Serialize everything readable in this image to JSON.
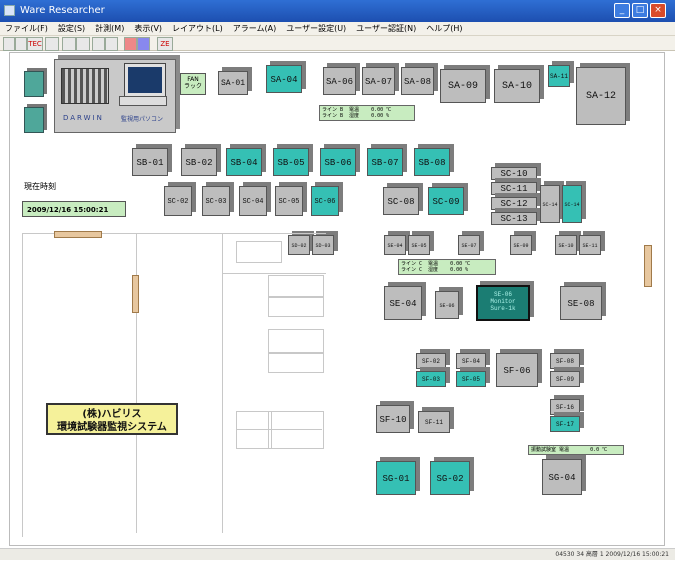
{
  "window": {
    "title": "Ware Researcher"
  },
  "menu": [
    "ファイル(F)",
    "設定(S)",
    "計測(M)",
    "表示(V)",
    "レイアウト(L)",
    "アラーム(A)",
    "ユーザー設定(U)",
    "ユーザー認証(N)",
    "ヘルプ(H)"
  ],
  "toolbar": {
    "buttons": [
      "",
      "",
      "TEC",
      "",
      "",
      "",
      "",
      "",
      "",
      "",
      "",
      "ZE"
    ]
  },
  "left_panel": {
    "darwin_label": "DARWIN",
    "pc_label": "監視用パソコン",
    "fan_rack": "FAN\nラック"
  },
  "clock": {
    "label": "現在時刻",
    "value": "2009/12/16  15:00:21"
  },
  "company": {
    "line1": "(株)ハビリス",
    "line2": "環境試験器監視システム"
  },
  "units": {
    "SA-01": "SA-01",
    "SA-04": "SA-04",
    "SA-06": "SA-06",
    "SA-07": "SA-07",
    "SA-08": "SA-08",
    "SA-09": "SA-09",
    "SA-10": "SA-10",
    "SA-11": "SA-11",
    "SA-12": "SA-12",
    "SB-01": "SB-01",
    "SB-02": "SB-02",
    "SB-04": "SB-04",
    "SB-05": "SB-05",
    "SB-06": "SB-06",
    "SB-07": "SB-07",
    "SB-08": "SB-08",
    "SC-02": "SC-02",
    "SC-03": "SC-03",
    "SC-04": "SC-04",
    "SC-05": "SC-05",
    "SC-06": "SC-06",
    "SC-08": "SC-08",
    "SC-09": "SC-09",
    "SC-10": "SC-10",
    "SC-11": "SC-11",
    "SC-12": "SC-12",
    "SC-13": "SC-13",
    "SC-14a": "SC-14",
    "SC-14b": "SC-14",
    "SD-02": "SD-02",
    "SD-03": "SD-03",
    "SE-04a": "SE-04",
    "SE-05": "SE-05",
    "SE-06": "SE-06",
    "SE-07": "SE-07",
    "SE-08a": "SE-08",
    "SE-09": "SE-09",
    "SE-10": "SE-10",
    "SE-11": "SE-11",
    "SE-04": "SE-04",
    "SE-06b": "SE-06",
    "SE-08": "SE-08",
    "monitor": "SE-06\nMonitor\nSure-1k",
    "SF-02": "SF-02",
    "SF-03": "SF-03",
    "SF-04": "SF-04",
    "SF-05": "SF-05",
    "SF-06": "SF-06",
    "SF-08": "SF-08",
    "SF-09": "SF-09",
    "SF-10": "SF-10",
    "SF-11": "SF-11",
    "SF-16": "SF-16",
    "SF-17": "SF-17",
    "SG-01": "SG-01",
    "SG-02": "SG-02",
    "SG-04": "SG-04"
  },
  "readouts": {
    "lineB": "ライン B  電温    0.00 ℃\nライン B  湿度    0.00 %",
    "lineC": "ライン C  電温    0.00 ℃\nライン C  湿度    0.00 %",
    "vib": "振動試験室 電温       0.0 ℃"
  },
  "status": {
    "text": "04530  34 高層 1  2009/12/16  15:00:21"
  },
  "colors": {
    "cyan": "#35c0b4",
    "gray": "#bdbdbd",
    "readout": "#c8ecc0",
    "titlebar": "#2f6fd4"
  }
}
